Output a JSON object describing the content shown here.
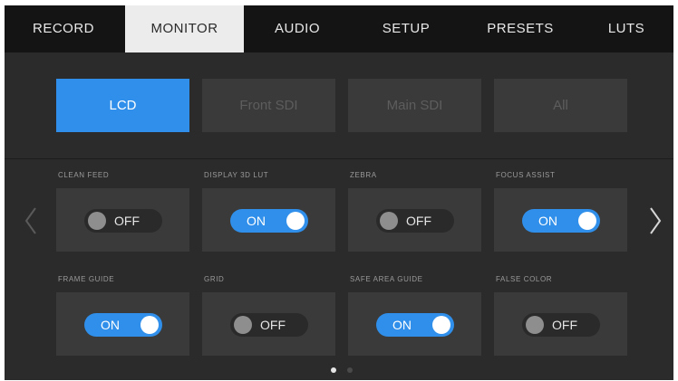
{
  "tabs": [
    {
      "label": "RECORD",
      "active": false
    },
    {
      "label": "MONITOR",
      "active": true
    },
    {
      "label": "AUDIO",
      "active": false
    },
    {
      "label": "SETUP",
      "active": false
    },
    {
      "label": "PRESETS",
      "active": false
    },
    {
      "label": "LUTS",
      "active": false
    }
  ],
  "outputs": [
    {
      "label": "LCD",
      "active": true
    },
    {
      "label": "Front SDI",
      "active": false
    },
    {
      "label": "Main SDI",
      "active": false
    },
    {
      "label": "All",
      "active": false
    }
  ],
  "settings": [
    {
      "label": "CLEAN FEED",
      "state": "OFF"
    },
    {
      "label": "DISPLAY 3D LUT",
      "state": "ON"
    },
    {
      "label": "ZEBRA",
      "state": "OFF"
    },
    {
      "label": "FOCUS ASSIST",
      "state": "ON"
    },
    {
      "label": "FRAME GUIDE",
      "state": "ON"
    },
    {
      "label": "GRID",
      "state": "OFF"
    },
    {
      "label": "SAFE AREA GUIDE",
      "state": "ON"
    },
    {
      "label": "FALSE COLOR",
      "state": "OFF"
    }
  ],
  "pagination": {
    "total": 2,
    "current": 1
  },
  "nav": {
    "prev_icon": "chevron-left-icon",
    "next_icon": "chevron-right-icon"
  },
  "colors": {
    "accent": "#2f8fea",
    "background": "#2b2b2b",
    "panel": "#3a3a3a"
  }
}
